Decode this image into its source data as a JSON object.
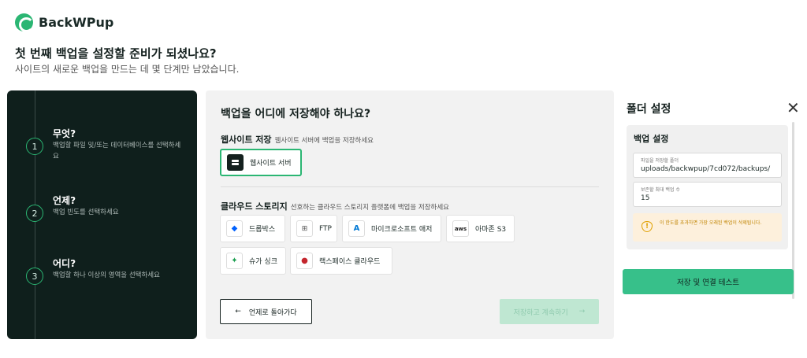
{
  "brand": {
    "name": "BackWPup"
  },
  "header": {
    "title": "첫 번째 백업을 설정할 준비가 되셨나요?",
    "subtitle": "사이트의 새로운 백업을 만드는 데 몇 단계만 남았습니다."
  },
  "steps": [
    {
      "num": "1",
      "title": "무엇?",
      "desc": "백업할 파일 및/또는 데이터베이스를 선택하세요"
    },
    {
      "num": "2",
      "title": "언제?",
      "desc": "백업 빈도를 선택하세요"
    },
    {
      "num": "3",
      "title": "어디?",
      "desc": "백업할 하나 이상의 영역을 선택하세요"
    }
  ],
  "main": {
    "title": "백업을 어디에 저장해야 하나요?",
    "website_storage": {
      "label": "웹사이트 저장",
      "hint": "웹사이트 서버에 백업을 저장하세요",
      "option": "웹사이트 서버"
    },
    "cloud_storage": {
      "label": "클라우드 스토리지",
      "hint": "선호하는 클라우드 스토리지 플랫폼에 백업을 저장하세요",
      "options": [
        "드롭박스",
        "FTP",
        "마이크로소프트 애저",
        "아마존 S3",
        "슈가 싱크",
        "랙스페이스 클라우드"
      ]
    },
    "back_label": "언제로 돌아가다",
    "next_label": "저장하고 계속하기"
  },
  "folder_settings": {
    "title": "폴더 설정",
    "card_title": "백업 설정",
    "folder_label": "파일을 저장할 폴더",
    "folder_value": "uploads/backwpup/7cd072/backups/",
    "max_label": "보존할 최대 백업 수",
    "max_value": "15",
    "warning": "이 한도를 초과하면 가장 오래된 백업이 삭제됩니다.",
    "save_label": "저장 및 연결 테스트"
  },
  "colors": {
    "accent": "#2bb673",
    "dark": "#0f1f1c",
    "button": "#37c08a",
    "warning_bg": "#fdf0dc"
  },
  "icons": [
    "close-icon",
    "arrow-left-icon",
    "arrow-right-icon",
    "warning-icon",
    "server-icon",
    "dropbox-icon",
    "ftp-icon",
    "azure-icon",
    "aws-icon",
    "sugarsync-icon",
    "rackspace-icon"
  ]
}
